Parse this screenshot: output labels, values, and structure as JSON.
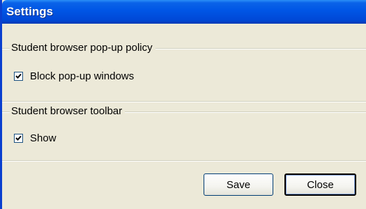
{
  "window": {
    "title": "Settings"
  },
  "groups": [
    {
      "legend": "Student browser pop-up policy",
      "checkbox": {
        "label": "Block pop-up windows",
        "checked": true
      }
    },
    {
      "legend": "Student browser toolbar",
      "checkbox": {
        "label": "Show",
        "checked": true
      }
    }
  ],
  "buttons": {
    "save_label": "Save",
    "close_label": "Close"
  },
  "colors": {
    "titlebar": "#0055e5",
    "window_bg": "#ece9d8",
    "checkbox_border": "#1c5180"
  }
}
